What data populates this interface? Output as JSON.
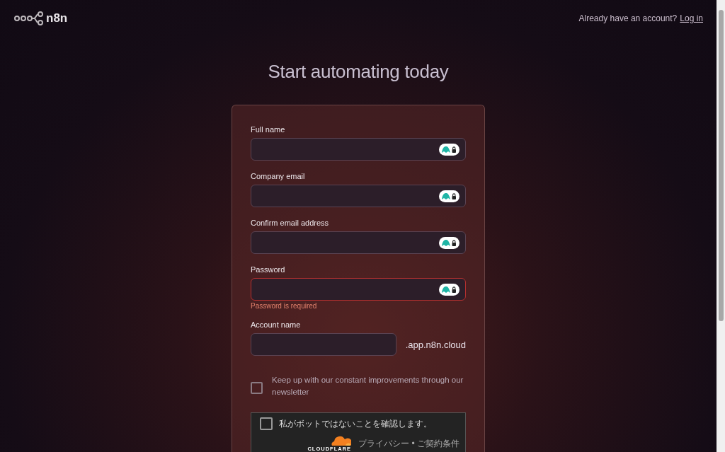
{
  "header": {
    "logo_text": "n8n",
    "prompt": "Already have an account?",
    "login_link": "Log in"
  },
  "title": "Start automating today",
  "fields": [
    {
      "label": "Full name",
      "kind": "password-manager",
      "invalid": false
    },
    {
      "label": "Company email",
      "kind": "password-manager",
      "invalid": false
    },
    {
      "label": "Confirm email address",
      "kind": "password-manager",
      "invalid": false
    },
    {
      "label": "Password",
      "kind": "password-manager",
      "invalid": true,
      "error": "Password is required"
    },
    {
      "label": "Account name",
      "kind": "suffix",
      "invalid": false,
      "suffix": ".app.n8n.cloud"
    }
  ],
  "newsletter": {
    "label": "Keep up with our constant improvements through our newsletter",
    "checked": false
  },
  "captcha": {
    "label": "私がボットではないことを確認します。",
    "checked": false,
    "brand": "CLOUDFLARE",
    "links": "プライバシー • ご契約条件"
  }
}
